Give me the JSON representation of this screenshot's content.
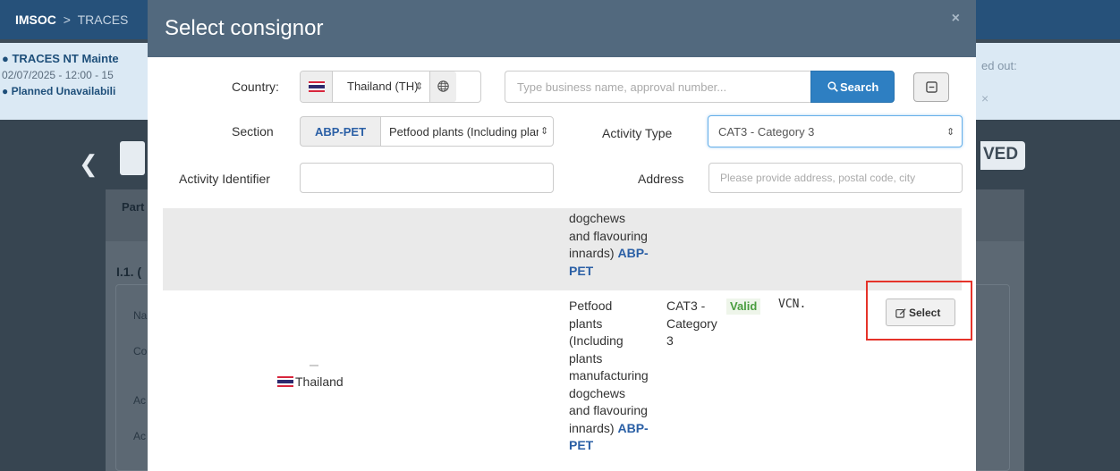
{
  "background": {
    "app_name": "IMSOC",
    "breadcrumb_sep": ">",
    "breadcrumb_current": "TRACES",
    "alert_title": "TRACES NT Mainte",
    "alert_dates": "02/07/2025 - 12:00 - 15",
    "alert_planned": "Planned Unavailabili",
    "alert_right_text": "ed out:",
    "alert_right_close": "×",
    "status_fragment": "VED",
    "tab_fragment": "Part",
    "section_fragment": "I.1. (",
    "field_fragments": [
      "Na",
      "Co",
      "Ac",
      "Ac"
    ]
  },
  "modal": {
    "title": "Select consignor",
    "close_glyph": "×",
    "filters": {
      "country_label": "Country:",
      "country_value": "Thailand (TH)",
      "search_placeholder": "Type business name, approval number...",
      "search_button": "Search",
      "section_label": "Section",
      "section_code": "ABP-PET",
      "section_value": "Petfood plants (Including plants manufacturing dogchews and flavouring innards)",
      "activity_type_label": "Activity Type",
      "activity_type_value": "CAT3 - Category 3",
      "activity_identifier_label": "Activity Identifier",
      "activity_identifier_value": "",
      "address_label": "Address",
      "address_placeholder": "Please provide address, postal code, city"
    },
    "results": [
      {
        "section_lines": [
          "dogchews",
          "and flavouring",
          "innards)"
        ],
        "section_code": "ABP-",
        "section_code_2": "PET"
      },
      {
        "country": "Thailand",
        "section_lines": [
          "Petfood",
          "plants",
          "(Including",
          "plants",
          "manufacturing",
          "dogchews",
          "and flavouring",
          "innards)"
        ],
        "section_code": "ABP-",
        "section_code_2": "PET",
        "activity_lines": [
          "CAT3 -",
          "Category",
          "3"
        ],
        "status": "Valid",
        "approval": "VCN.",
        "select_label": "Select"
      }
    ]
  },
  "colors": {
    "header_bg": "#52697e",
    "primary": "#2e7fc2",
    "code_blue": "#2a5fa5",
    "valid_green": "#4a9d3f",
    "highlight_red": "#e5332a"
  },
  "icons": [
    "thailand-flag-icon",
    "globe-icon",
    "chevron-updown-icon",
    "search-icon",
    "collapse-icon",
    "edit-icon",
    "info-icon"
  ]
}
